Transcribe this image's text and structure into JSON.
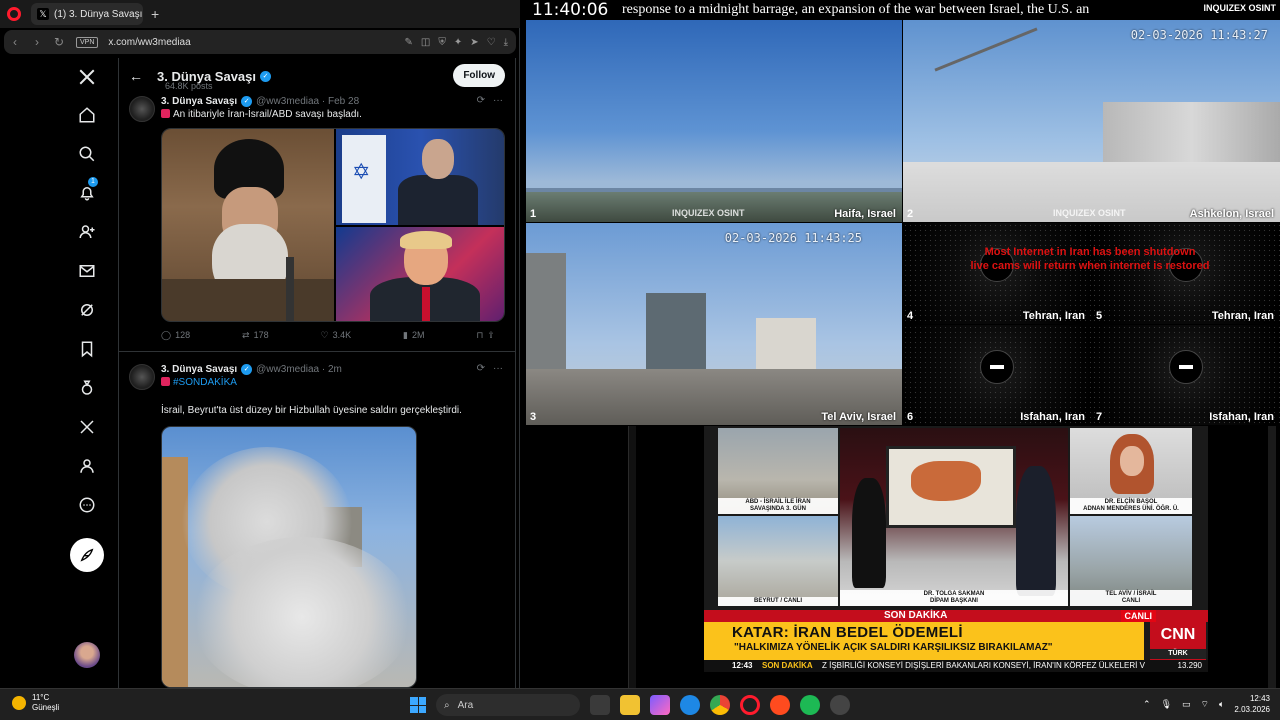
{
  "browser": {
    "tab_title": "(1) 3. Dünya Savaşı (@ww",
    "vpn": "VPN",
    "url": "x.com/ww3mediaa"
  },
  "x_sidebar": {
    "notif_count": "1"
  },
  "profile": {
    "name": "3. Dünya Savaşı",
    "posts": "64.8K posts",
    "follow_label": "Follow"
  },
  "tweets": [
    {
      "name": "3. Dünya Savaşı",
      "handle": "@ww3mediaa · Feb 28",
      "text": "An itibariyle İran-İsrail/ABD savaşı başladı.",
      "replies": "128",
      "reposts": "178",
      "likes": "3.4K",
      "views": "2M"
    },
    {
      "name": "3. Dünya Savaşı",
      "handle": "@ww3mediaa · 2m",
      "hashtag": "#SONDAKİKA",
      "text": "İsrail, Beyrut'ta üst düzey bir Hizbullah üyesine saldırı gerçekleştirdi."
    }
  ],
  "feed": {
    "clock": "11:40:06",
    "ticker": "response to a midnight barrage, an expansion of the war between Israel, the U.S. an",
    "logo": "INQUIZEX OSINT",
    "note_line1": "Most Internet in Iran has been shutdown",
    "note_line2": "live cams will return when internet is restored",
    "cams": [
      {
        "num": "1",
        "city": "Haifa, Israel"
      },
      {
        "num": "2",
        "city": "Ashkelon, Israel",
        "ts": "02-03-2026 11:43:27"
      },
      {
        "num": "3",
        "city": "Tel Aviv, Israel",
        "ts": "02-03-2026 11:43:25"
      },
      {
        "num": "4",
        "city": "Tehran, Iran"
      },
      {
        "num": "5",
        "city": "Tehran, Iran"
      },
      {
        "num": "6",
        "city": "Isfahan, Iran"
      },
      {
        "num": "7",
        "city": "Isfahan, Iran"
      }
    ]
  },
  "cnn": {
    "cap_a1": "ABD - İSRAİL İLE İRAN",
    "cap_a2": "SAVAŞINDA 3. GÜN",
    "cap_b": "BEYRUT / CANLI",
    "cap_studio1": "DR. TOLGA SAKMAN",
    "cap_studio2": "DİPAM BAŞKANI",
    "cap_c1": "DR. ELÇİN BAŞOL",
    "cap_c2": "ADNAN MENDERES ÜNİ. ÖĞR. Ü.",
    "cap_d1": "TEL AVİV / İSRAİL",
    "cap_d2": "CANLI",
    "son_dakika": "SON DAKİKA",
    "canli": "CANLI",
    "headline": "KATAR: İRAN BEDEL ÖDEMELİ",
    "subhead": "\"HALKIMIZA YÖNELİK AÇIK SALDIRI KARŞILIKSIZ BIRAKILAMAZ\"",
    "logo": "CNN",
    "logo_sub": "TÜRK",
    "bar_time": "12:43",
    "bar_sd": "SON DAKİKA",
    "bar_news": "Z İŞBİRLİĞİ KONSEYİ DIŞİŞLERİ BAKANLARI KONSEYİ, İRAN'IN KÖRFEZ ÜLKELERİ V",
    "bar_stock": "13.290"
  },
  "taskbar": {
    "temp": "11°C",
    "weather": "Güneşli",
    "search_placeholder": "Ara",
    "time": "12:43",
    "date": "2.03.2026"
  }
}
